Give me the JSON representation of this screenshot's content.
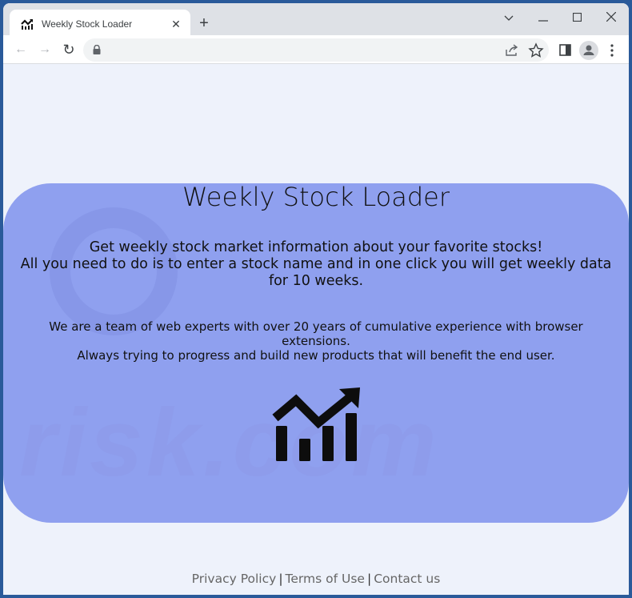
{
  "browser": {
    "tab": {
      "title": "Weekly Stock Loader",
      "icon": "chart-growth-icon"
    },
    "new_tab_label": "+",
    "window_controls": [
      "chevron-down-icon",
      "minimize-icon",
      "maximize-icon",
      "close-icon"
    ],
    "nav": {
      "back": "←",
      "forward": "→",
      "reload": "↻"
    },
    "address": {
      "value": ""
    }
  },
  "hero": {
    "title": "Weekly Stock Loader",
    "intro_line1": "Get weekly stock market information about your favorite stocks!",
    "intro_line2": "All you need to do is to enter a stock name and in one click you will get weekly data for 10 weeks.",
    "about_line1": "We are a team of web experts with over 20 years of cumulative experience with browser extensions.",
    "about_line2": "Always trying to progress and build new products that will benefit the end user.",
    "watermark": "risk.com",
    "colors": {
      "panel": "#8fa0ef",
      "text": "#111111"
    }
  },
  "footer": {
    "links": [
      "Privacy Policy",
      "Terms of Use",
      "Contact us"
    ],
    "separator": "|"
  }
}
